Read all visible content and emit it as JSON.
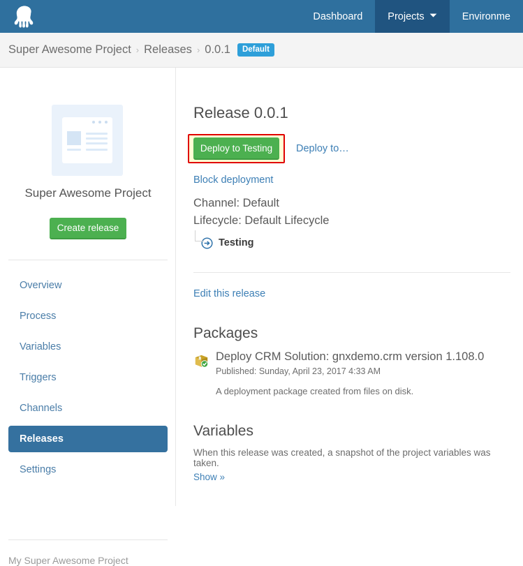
{
  "colors": {
    "nav_blue": "#2F709E",
    "nav_active_blue": "#205480",
    "accent_link": "#3D7FB5",
    "green_button": "#4CB050",
    "badge_blue": "#2E9FD9",
    "highlight_border": "#E00000",
    "highlight_fill": "#FFFFD4",
    "sidebar_active": "#35719F"
  },
  "topnav": {
    "logo_icon": "octopus-logo-icon",
    "items": [
      {
        "label": "Dashboard",
        "active": false
      },
      {
        "label": "Projects",
        "active": true,
        "caret": "⌄",
        "caret_icon": "chevron-down-icon"
      },
      {
        "label": "Environme",
        "active": false
      }
    ]
  },
  "breadcrumb": {
    "items": [
      {
        "label": "Super Awesome Project"
      },
      {
        "label": "Releases"
      },
      {
        "label": "0.0.1"
      }
    ],
    "separator": "›",
    "badge": "Default"
  },
  "sidebar": {
    "project_logo_icon": "project-thumbnail-icon",
    "project_name": "Super Awesome Project",
    "create_release_label": "Create release",
    "items": [
      {
        "label": "Overview",
        "active": false
      },
      {
        "label": "Process",
        "active": false
      },
      {
        "label": "Variables",
        "active": false
      },
      {
        "label": "Triggers",
        "active": false
      },
      {
        "label": "Channels",
        "active": false
      },
      {
        "label": "Releases",
        "active": true
      },
      {
        "label": "Settings",
        "active": false
      }
    ],
    "footer_label": "My Super Awesome Project"
  },
  "main": {
    "title": "Release 0.0.1",
    "deploy_button_label": "Deploy to Testing",
    "deploy_to_link": "Deploy to…",
    "block_deployment_link": "Block deployment",
    "channel_line": "Channel: Default",
    "lifecycle_line": "Lifecycle: Default Lifecycle",
    "phase": {
      "icon": "arrow-circle-right-icon",
      "name": "Testing"
    },
    "edit_release_link": "Edit this release",
    "packages": {
      "heading": "Packages",
      "icon": "package-verified-icon",
      "title": "Deploy CRM Solution: gnxdemo.crm version 1.108.0",
      "published": "Published: Sunday, April 23, 2017 4:33 AM",
      "description": "A deployment package created from files on disk."
    },
    "variables": {
      "heading": "Variables",
      "description": "When this release was created, a snapshot of the project variables was taken.",
      "show_link": "Show »"
    }
  }
}
